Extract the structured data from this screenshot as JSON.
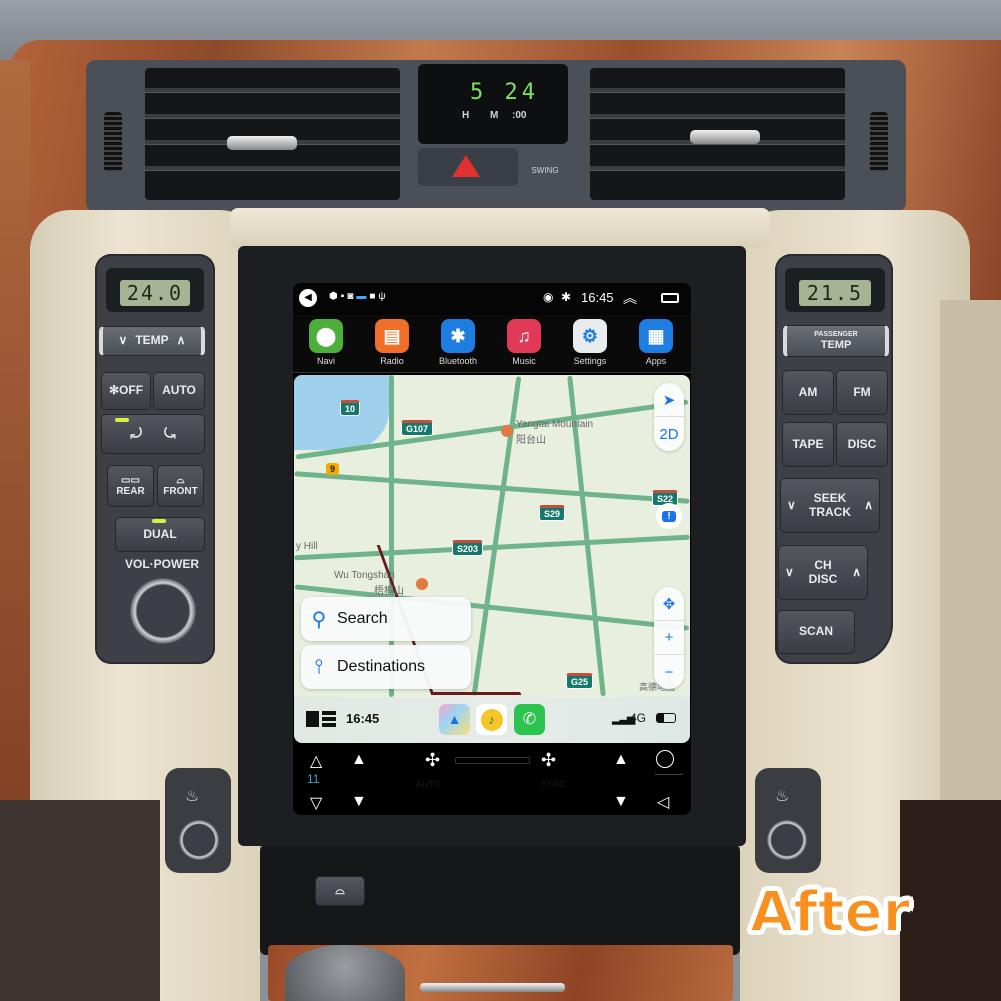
{
  "dashboard": {
    "clock": {
      "display": "5 24",
      "h_label": "H",
      "m_label": "M",
      "zero_label": ":00"
    },
    "swing_label": "SWING",
    "left_panel": {
      "temp_display": "24.0",
      "temp_label": "TEMP",
      "temp_down": "∨",
      "temp_up": "∧",
      "fan_off_label": "✻OFF",
      "auto_label": "AUTO",
      "rear_label": "REAR",
      "front_label": "FRONT",
      "dual_label": "DUAL",
      "vol_power_label": "VOL·POWER"
    },
    "right_panel": {
      "temp_display": "21.5",
      "passenger_label": "PASSENGER",
      "temp_label": "TEMP",
      "am_label": "AM",
      "fm_label": "FM",
      "tape_label": "TAPE",
      "disc_label": "DISC",
      "seek_track_label": "SEEK\nTRACK",
      "ch_disc_label": "CH\nDISC",
      "scan_label": "SCAN",
      "down": "∨",
      "up": "∧"
    },
    "after_badge": "After"
  },
  "headunit": {
    "statusbar": {
      "time": "16:45",
      "left_icons": [
        "back-icon",
        "location-icon",
        "image-icon",
        "screenshot-icon",
        "message-icon",
        "square-icon",
        "usb-icon"
      ],
      "right_icons": [
        "hotspot-icon",
        "bluetooth-icon",
        "expand-up-icon",
        "recent-apps-icon"
      ]
    },
    "apps": [
      {
        "label": "Navi",
        "icon": "map-pin-icon",
        "color": "#4caf3a",
        "glyph": "⬤"
      },
      {
        "label": "Radio",
        "icon": "radio-icon",
        "color": "#f0702a",
        "glyph": "▤"
      },
      {
        "label": "Bluetooth",
        "icon": "bluetooth-icon",
        "color": "#1d7de0",
        "glyph": "✱"
      },
      {
        "label": "Music",
        "icon": "music-note-icon",
        "color": "#e03a58",
        "glyph": "♫"
      },
      {
        "label": "Settings",
        "icon": "gear-icon",
        "color": "#e9ecef",
        "glyph": "⚙"
      },
      {
        "label": "Apps",
        "icon": "grid-icon",
        "color": "#1d7de0",
        "glyph": "▦"
      }
    ],
    "map": {
      "shields": [
        "10",
        "G107",
        "9",
        "S29",
        "S22",
        "S203",
        "G25"
      ],
      "labels": {
        "yangtai_en": "Yangtai Mountain",
        "yangtai_zh": "阳台山",
        "wutongshan_en": "Wu Tongshan",
        "wutongshan_zh": "梧桐山",
        "hill": "y Hill",
        "attribution": "高德地图"
      },
      "search_label": "Search",
      "destinations_label": "Destinations",
      "controls": {
        "locate": "➤",
        "view_mode": "2D",
        "pan": "✥",
        "zoom_in": "+",
        "zoom_out": "−",
        "report": "!"
      }
    },
    "carplay_dock": {
      "time": "16:45",
      "network": "4G",
      "apps": [
        "maps-icon",
        "qq-music-icon",
        "phone-icon"
      ]
    },
    "climate_bar": {
      "temp_value": "11",
      "dim_labels": {
        "auto": "AUTO",
        "sync": "SYNC"
      }
    }
  }
}
